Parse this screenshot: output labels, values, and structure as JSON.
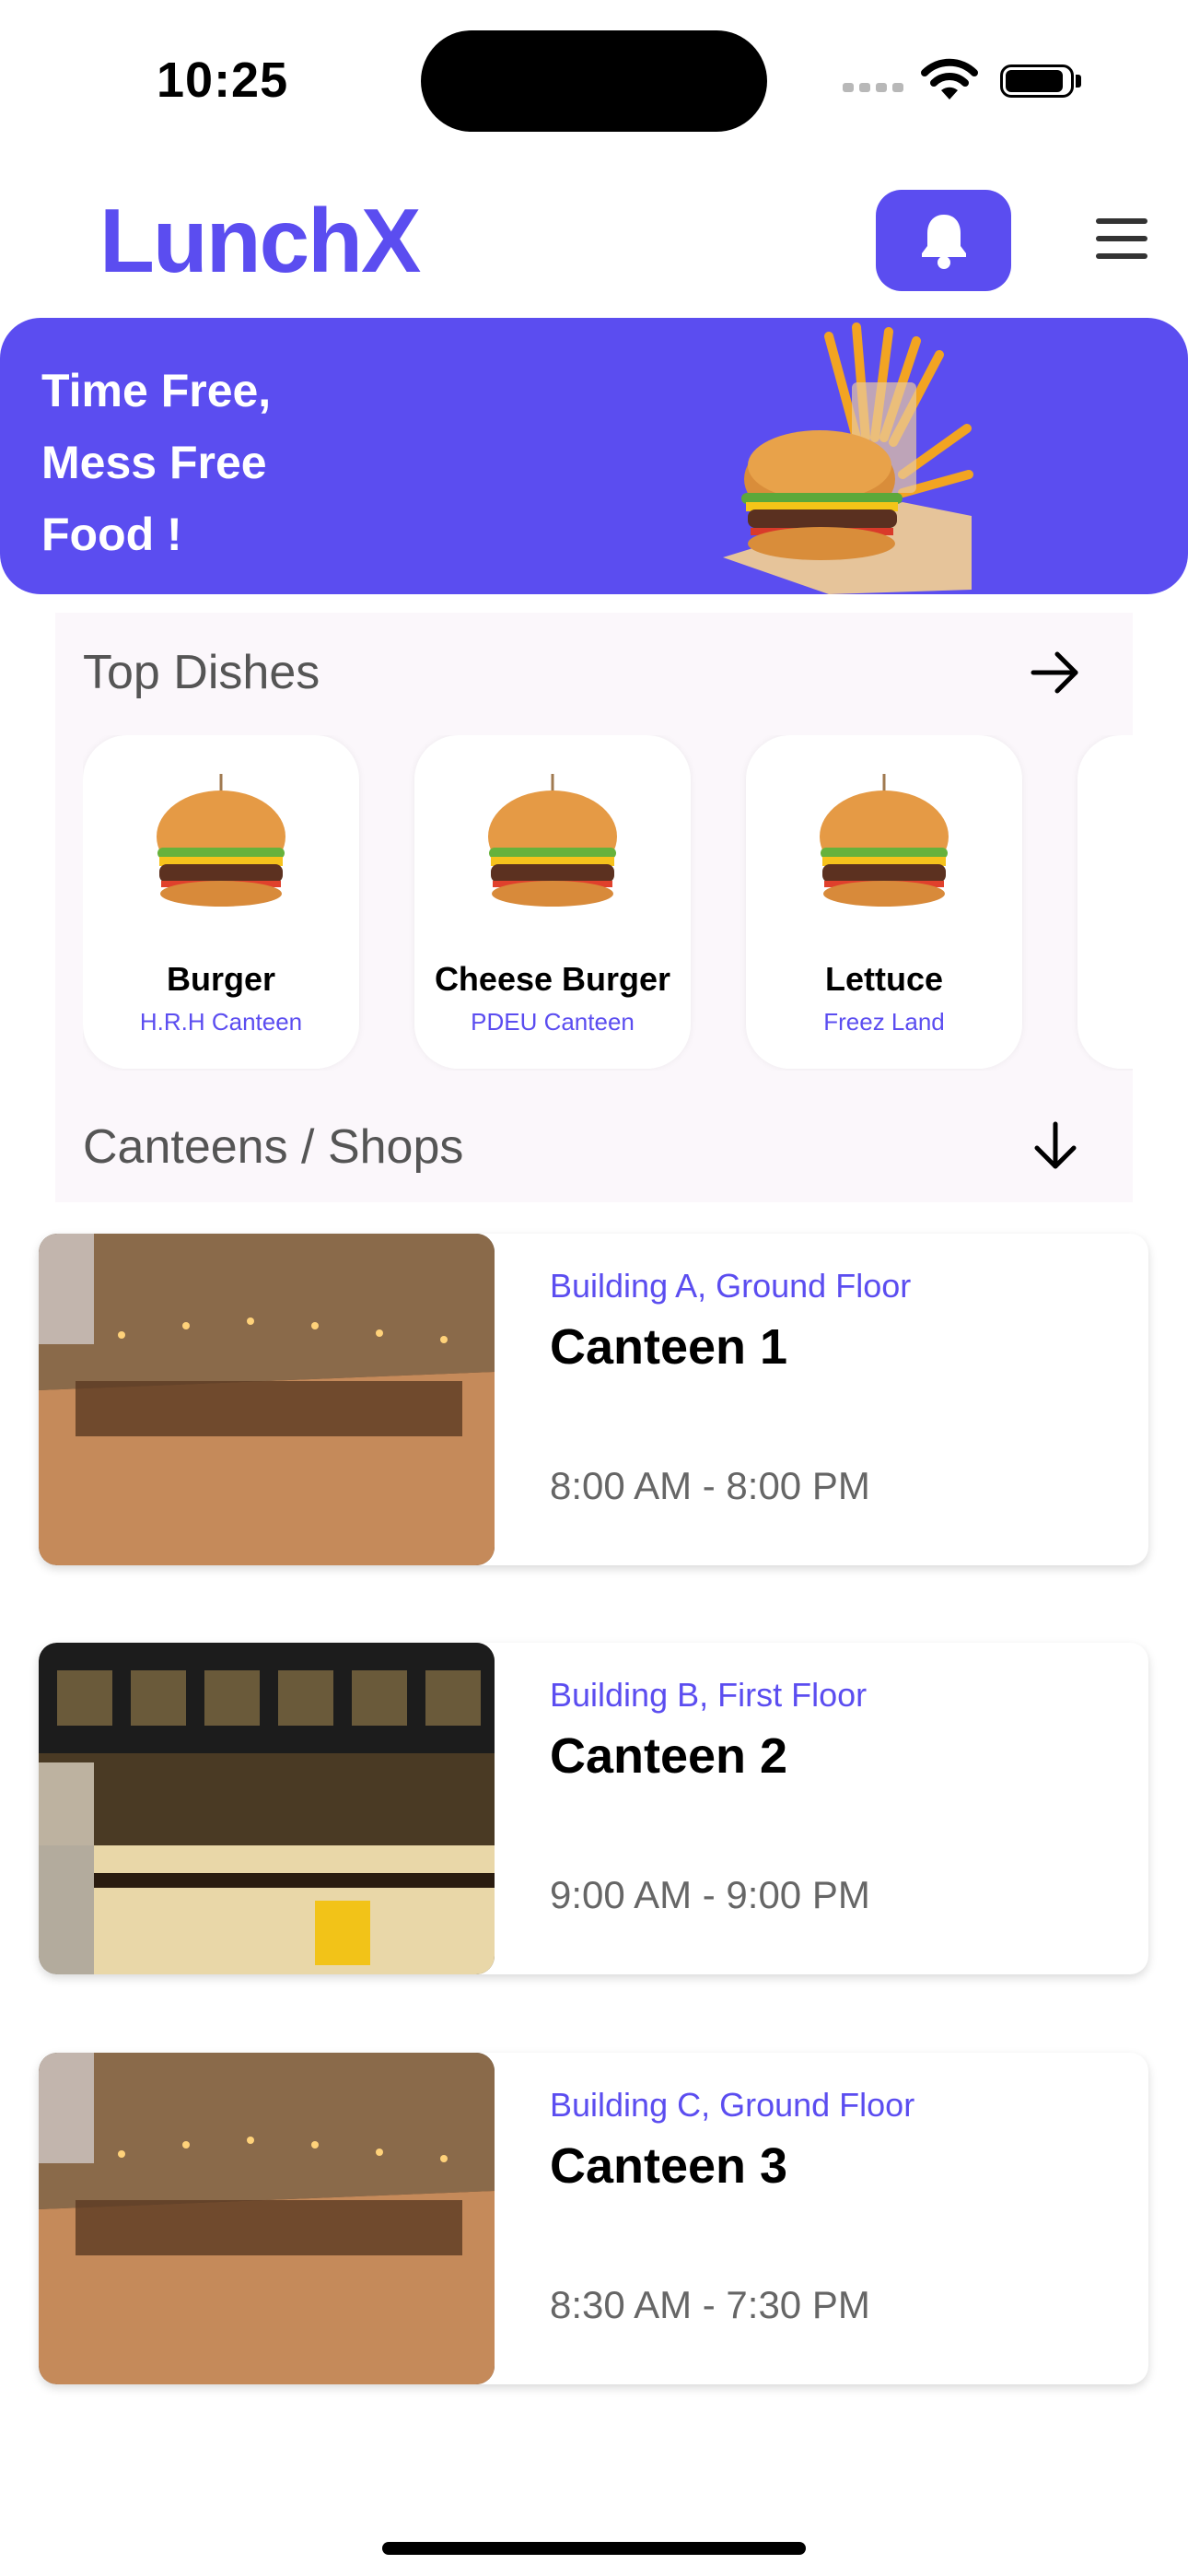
{
  "status_bar": {
    "time": "10:25"
  },
  "header": {
    "logo": "LunchX",
    "bell_icon": "bell-icon",
    "menu_icon": "hamburger-menu-icon"
  },
  "banner": {
    "line1": "Time Free,",
    "line2": "Mess Free",
    "line3": "Food !"
  },
  "top_dishes": {
    "title": "Top Dishes",
    "items": [
      {
        "name": "Burger",
        "location": "H.R.H Canteen"
      },
      {
        "name": "Cheese Burger",
        "location": "PDEU Canteen"
      },
      {
        "name": "Lettuce",
        "location": "Freez Land"
      }
    ]
  },
  "canteens": {
    "title": "Canteens / Shops",
    "items": [
      {
        "where": "Building A, Ground Floor",
        "name": "Canteen 1",
        "hours": "8:00 AM - 8:00 PM"
      },
      {
        "where": "Building B, First Floor",
        "name": "Canteen 2",
        "hours": "9:00 AM - 9:00 PM"
      },
      {
        "where": "Building C, Ground Floor",
        "name": "Canteen 3",
        "hours": "8:30 AM - 7:30 PM"
      }
    ]
  },
  "colors": {
    "accent": "#5b4df0",
    "muted_text": "#555555"
  }
}
